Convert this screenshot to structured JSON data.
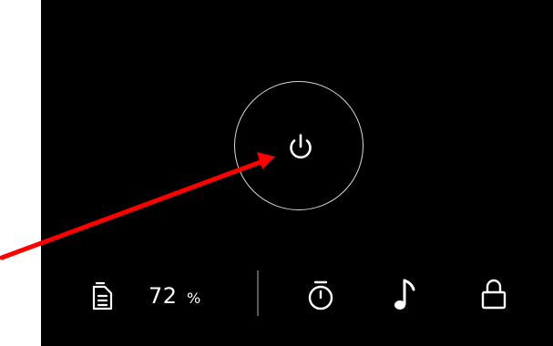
{
  "status": {
    "battery_value": "72",
    "battery_unit": "%"
  },
  "controls": {
    "power": {
      "icon": "power-icon"
    },
    "filter": {
      "icon": "filter-document-icon"
    },
    "timer": {
      "icon": "timer-icon"
    },
    "music": {
      "icon": "music-note-icon"
    },
    "lock": {
      "icon": "lock-icon"
    }
  },
  "annotation": {
    "color": "#ff0000",
    "target": "power-button"
  },
  "colors": {
    "panel": "#000000",
    "foreground": "#ffffff",
    "ring": "#d8d8d8",
    "divider": "#5a5a5a"
  }
}
